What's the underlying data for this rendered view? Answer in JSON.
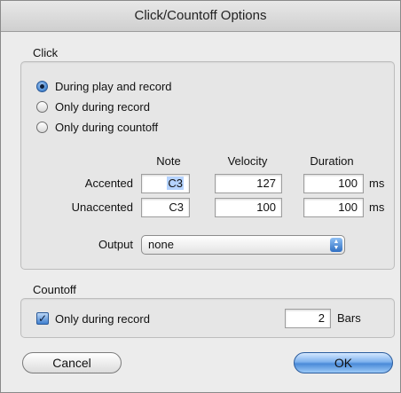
{
  "window": {
    "title": "Click/Countoff Options"
  },
  "click_group": {
    "label": "Click",
    "radios": [
      {
        "label": "During play and record",
        "selected": true
      },
      {
        "label": "Only during record",
        "selected": false
      },
      {
        "label": "Only during countoff",
        "selected": false
      }
    ],
    "columns": {
      "note": "Note",
      "velocity": "Velocity",
      "duration": "Duration"
    },
    "rows": [
      {
        "label": "Accented",
        "note": "C3",
        "velocity": "127",
        "duration": "100",
        "unit": "ms"
      },
      {
        "label": "Unaccented",
        "note": "C3",
        "velocity": "100",
        "duration": "100",
        "unit": "ms"
      }
    ],
    "output": {
      "label": "Output",
      "value": "none"
    }
  },
  "countoff_group": {
    "label": "Countoff",
    "checkbox": {
      "label": "Only during record",
      "checked": true
    },
    "bars": {
      "value": "2",
      "unit": "Bars"
    }
  },
  "buttons": {
    "cancel": "Cancel",
    "ok": "OK"
  }
}
